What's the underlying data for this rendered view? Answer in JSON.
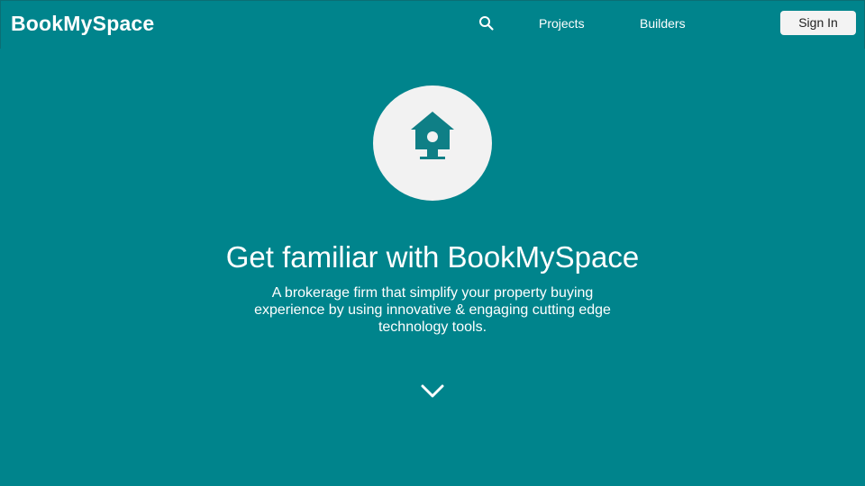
{
  "header": {
    "brand": "BookMySpace",
    "search_icon": "search-icon",
    "nav": {
      "projects": "Projects",
      "builders": "Builders"
    },
    "signin_label": "Sign In"
  },
  "hero": {
    "icon": "birdhouse-icon",
    "title": "Get familiar with BookMySpace",
    "subtitle": "A brokerage firm that simplify your property buying experience by using innovative & engaging cutting edge technology tools.",
    "scroll_icon": "chevron-down-icon"
  },
  "colors": {
    "background": "#00848c",
    "circle": "#f2f2f2",
    "icon": "#0f7f86",
    "button": "#f3f3f3"
  }
}
